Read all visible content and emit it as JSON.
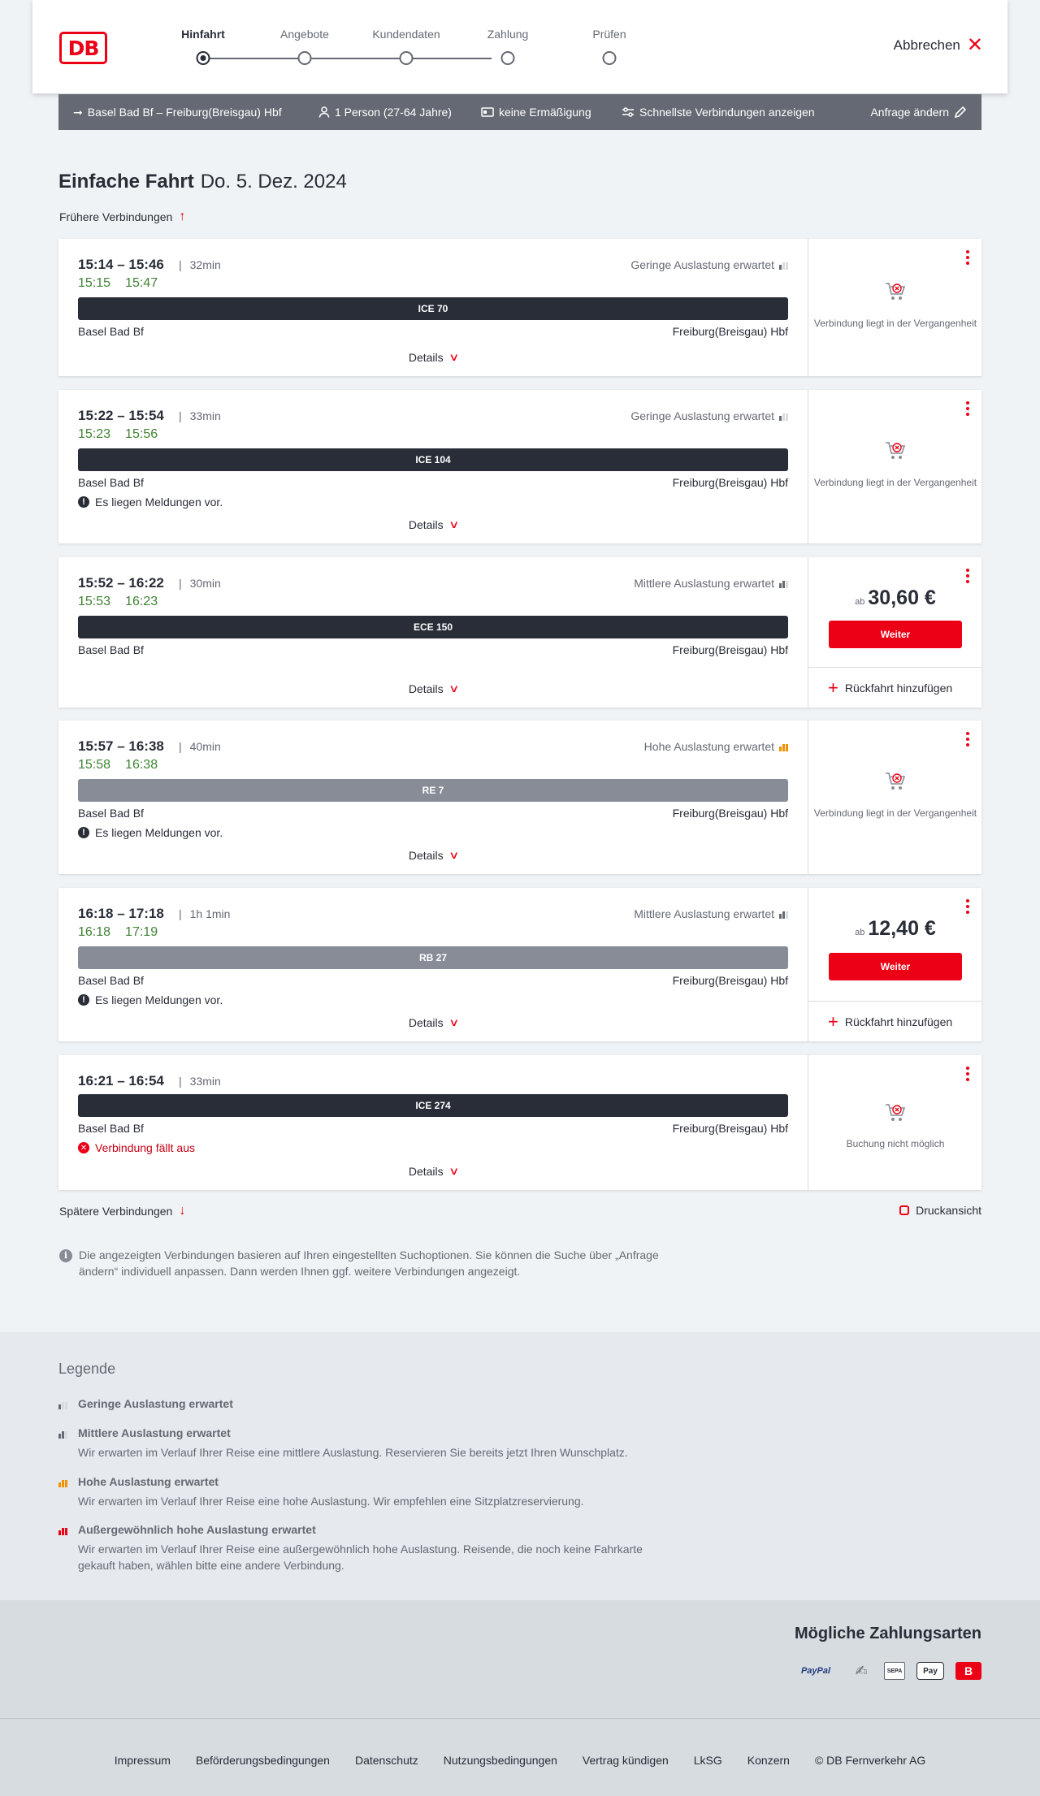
{
  "logo": "DB",
  "stepper": {
    "steps": [
      "Hinfahrt",
      "Angebote",
      "Kundendaten",
      "Zahlung",
      "Prüfen"
    ],
    "active_index": 0
  },
  "header": {
    "cancel_label": "Abbrechen"
  },
  "searchbar": {
    "route": "Basel Bad Bf – Freiburg(Breisgau) Hbf",
    "travellers": "1 Person (27-64 Jahre)",
    "discount": "keine Ermäßigung",
    "fastest": "Schnellste Verbindungen anzeigen",
    "change": "Anfrage ändern"
  },
  "page": {
    "title": "Einfache Fahrt",
    "date": "Do. 5. Dez. 2024",
    "earlier": "Frühere Verbindungen",
    "later": "Spätere Verbindungen",
    "print": "Druckansicht",
    "info": "Die angezeigten Verbindungen basieren auf Ihren eingestellten Suchoptionen. Sie können die Suche über „Anfrage ändern“ individuell anpassen. Dann werden Ihnen ggf. weitere Verbindungen angezeigt."
  },
  "connections": [
    {
      "times": "15:14 – 15:46",
      "duration": "32min",
      "rt_dep": "15:15",
      "rt_arr": "15:47",
      "load": "Geringe Auslastung erwartet",
      "train": "ICE 70",
      "from": "Basel Bad Bf",
      "to": "Freiburg(Breisgau) Hbf",
      "details": "Details",
      "status": "Verbindung liegt in der Vergangenheit"
    },
    {
      "times": "15:22 – 15:54",
      "duration": "33min",
      "rt_dep": "15:23",
      "rt_arr": "15:56",
      "load": "Geringe Auslastung erwartet",
      "train": "ICE 104",
      "from": "Basel Bad Bf",
      "to": "Freiburg(Breisgau) Hbf",
      "message": "Es liegen Meldungen vor.",
      "details": "Details",
      "status": "Verbindung liegt in der Vergangenheit"
    },
    {
      "times": "15:52 – 16:22",
      "duration": "30min",
      "rt_dep": "15:53",
      "rt_arr": "16:23",
      "load": "Mittlere Auslastung erwartet",
      "train": "ECE 150",
      "from": "Basel Bad Bf",
      "to": "Freiburg(Breisgau) Hbf",
      "details": "Details",
      "price_prefix": "ab",
      "price": "30,60 €",
      "button": "Weiter",
      "return": "Rückfahrt hinzufügen"
    },
    {
      "times": "15:57 – 16:38",
      "duration": "40min",
      "rt_dep": "15:58",
      "rt_arr": "16:38",
      "load": "Hohe Auslastung erwartet",
      "train": "RE 7",
      "from": "Basel Bad Bf",
      "to": "Freiburg(Breisgau) Hbf",
      "message": "Es liegen Meldungen vor.",
      "details": "Details",
      "status": "Verbindung liegt in der Vergangenheit"
    },
    {
      "times": "16:18 – 17:18",
      "duration": "1h 1min",
      "rt_dep": "16:18",
      "rt_arr": "17:19",
      "load": "Mittlere Auslastung erwartet",
      "train": "RB 27",
      "from": "Basel Bad Bf",
      "to": "Freiburg(Breisgau) Hbf",
      "message": "Es liegen Meldungen vor.",
      "details": "Details",
      "price_prefix": "ab",
      "price": "12,40 €",
      "button": "Weiter",
      "return": "Rückfahrt hinzufügen"
    },
    {
      "times": "16:21 – 16:54",
      "duration": "33min",
      "train": "ICE 274",
      "from": "Basel Bad Bf",
      "to": "Freiburg(Breisgau) Hbf",
      "message": "Verbindung fällt aus",
      "details": "Details",
      "status": "Buchung nicht möglich"
    }
  ],
  "legend": {
    "title": "Legende",
    "items": [
      {
        "title": "Geringe Auslastung erwartet",
        "text": ""
      },
      {
        "title": "Mittlere Auslastung erwartet",
        "text": "Wir erwarten im Verlauf Ihrer Reise eine mittlere Auslastung. Reservieren Sie bereits jetzt Ihren Wunschplatz."
      },
      {
        "title": "Hohe Auslastung erwartet",
        "text": "Wir erwarten im Verlauf Ihrer Reise eine hohe Auslastung. Wir empfehlen eine Sitzplatzreservierung."
      },
      {
        "title": "Außergewöhnlich hohe Auslastung erwartet",
        "text": "Wir erwarten im Verlauf Ihrer Reise eine außergewöhnlich hohe Auslastung. Reisende, die noch keine Fahrkarte gekauft haben, wählen bitte eine andere Verbindung."
      }
    ]
  },
  "payments": {
    "title": "Mögliche Zahlungsarten",
    "paypal": "PayPal",
    "sepa": "SEPA",
    "apple": "Pay"
  },
  "footer": {
    "links": [
      "Impressum",
      "Beförderungsbedingungen",
      "Datenschutz",
      "Nutzungsbedingungen",
      "Vertrag kündigen",
      "LkSG",
      "Konzern",
      "© DB Fernverkehr AG"
    ]
  },
  "colors": {
    "accent": "#ec0016",
    "realtime": "#408335",
    "dark": "#282d37",
    "searchbar": "#646973"
  },
  "icons": [
    "arrow-right-icon",
    "person-icon",
    "card-icon",
    "filter-icon",
    "pencil-icon",
    "close-icon",
    "arrow-up-icon",
    "arrow-down-icon",
    "kebab-icon",
    "cart-cross-icon",
    "plus-icon",
    "printer-icon",
    "info-icon",
    "load-icon"
  ]
}
